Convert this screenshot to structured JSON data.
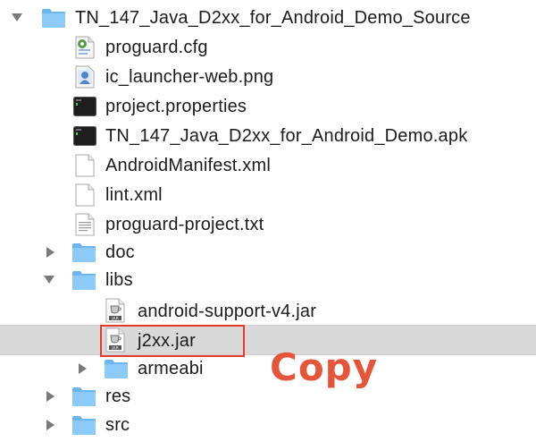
{
  "finder": {
    "rows": [
      {
        "label": "TN_147_Java_D2xx_for_Android_Demo_Source",
        "icon": "folder-icon",
        "expanded": true
      },
      {
        "label": "proguard.cfg",
        "icon": "config-file-icon"
      },
      {
        "label": "ic_launcher-web.png",
        "icon": "image-file-icon"
      },
      {
        "label": "project.properties",
        "icon": "exec-file-icon"
      },
      {
        "label": "TN_147_Java_D2xx_for_Android_Demo.apk",
        "icon": "exec-file-icon"
      },
      {
        "label": "AndroidManifest.xml",
        "icon": "document-icon"
      },
      {
        "label": "lint.xml",
        "icon": "document-icon"
      },
      {
        "label": "proguard-project.txt",
        "icon": "text-file-icon"
      },
      {
        "label": "doc",
        "icon": "folder-icon",
        "expanded": false
      },
      {
        "label": "libs",
        "icon": "folder-icon",
        "expanded": true
      },
      {
        "label": "android-support-v4.jar",
        "icon": "jar-file-icon"
      },
      {
        "label": "j2xx.jar",
        "icon": "jar-file-icon",
        "selected": true
      },
      {
        "label": "armeabi",
        "icon": "folder-icon",
        "expanded": false
      },
      {
        "label": "res",
        "icon": "folder-icon",
        "expanded": false
      },
      {
        "label": "src",
        "icon": "folder-icon",
        "expanded": false
      }
    ]
  },
  "annotation": {
    "text": "Copy",
    "color": "#e5553a"
  }
}
